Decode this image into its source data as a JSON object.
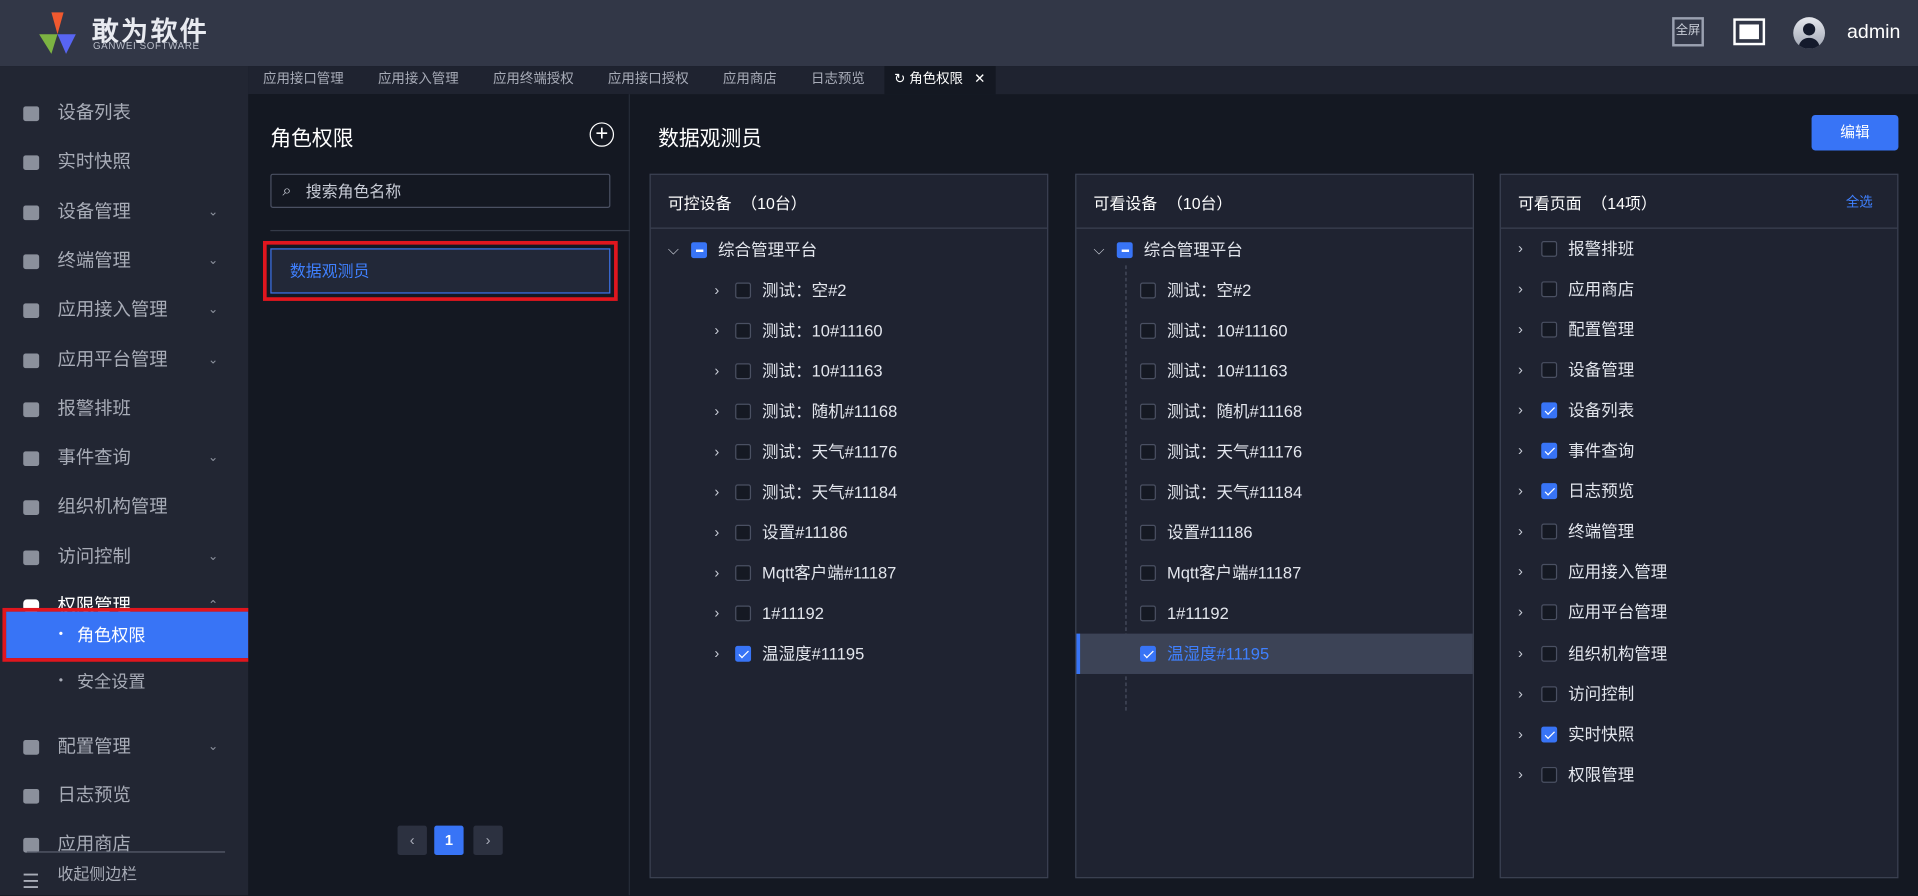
{
  "header": {
    "logo_text": "敢为软件",
    "logo_sub": "GANWEI SOFTWARE",
    "fullscreen_text_label": "全屏",
    "username": "admin"
  },
  "tabs": [
    "应用接口管理",
    "应用接入管理",
    "应用终端授权",
    "应用接口授权",
    "应用商店",
    "日志预览",
    "角色权限"
  ],
  "sidebar": {
    "items": [
      {
        "label": "设备列表",
        "icon": "monitor-icon",
        "chev": ""
      },
      {
        "label": "实时快照",
        "icon": "camera-icon",
        "chev": ""
      },
      {
        "label": "设备管理",
        "icon": "grid-icon",
        "chev": "⌄"
      },
      {
        "label": "终端管理",
        "icon": "grid-icon",
        "chev": "⌄"
      },
      {
        "label": "应用接入管理",
        "icon": "grid-icon",
        "chev": "⌄"
      },
      {
        "label": "应用平台管理",
        "icon": "grid-icon",
        "chev": "⌄"
      },
      {
        "label": "报警排班",
        "icon": "calendar-icon",
        "chev": ""
      },
      {
        "label": "事件查询",
        "icon": "search-doc-icon",
        "chev": "⌄"
      },
      {
        "label": "组织机构管理",
        "icon": "gear-icon",
        "chev": ""
      },
      {
        "label": "访问控制",
        "icon": "door-icon",
        "chev": "⌄"
      },
      {
        "label": "权限管理",
        "icon": "shield-icon",
        "chev": "⌃"
      }
    ],
    "sub_items": [
      {
        "label": "角色权限"
      },
      {
        "label": "安全设置"
      }
    ],
    "items_after": [
      {
        "label": "配置管理",
        "icon": "bookmark-icon",
        "chev": "⌄"
      },
      {
        "label": "日志预览",
        "icon": "receipt-icon",
        "chev": ""
      },
      {
        "label": "应用商店",
        "icon": "store-icon",
        "chev": ""
      }
    ],
    "collapse_label": "收起侧边栏"
  },
  "roles": {
    "title": "角色权限",
    "search_placeholder": "搜索角色名称",
    "items": [
      "数据观测员"
    ],
    "page": "1"
  },
  "main": {
    "title": "数据观测员",
    "edit_label": "编辑"
  },
  "panels": [
    {
      "title": "可控设备",
      "count": "（10台）",
      "root": "综合管理平台",
      "items": [
        {
          "label": "测试：空#2",
          "checked": false
        },
        {
          "label": "测试：10#11160",
          "checked": false
        },
        {
          "label": "测试：10#11163",
          "checked": false
        },
        {
          "label": "测试：随机#11168",
          "checked": false
        },
        {
          "label": "测试：天气#11176",
          "checked": false
        },
        {
          "label": "测试：天气#11184",
          "checked": false
        },
        {
          "label": "设置#11186",
          "checked": false
        },
        {
          "label": "Mqtt客户端#11187",
          "checked": false
        },
        {
          "label": "1#11192",
          "checked": false
        },
        {
          "label": "温湿度#11195",
          "checked": true
        }
      ]
    },
    {
      "title": "可看设备",
      "count": "（10台）",
      "root": "综合管理平台",
      "items": [
        {
          "label": "测试：空#2",
          "checked": false
        },
        {
          "label": "测试：10#11160",
          "checked": false
        },
        {
          "label": "测试：10#11163",
          "checked": false
        },
        {
          "label": "测试：随机#11168",
          "checked": false
        },
        {
          "label": "测试：天气#11176",
          "checked": false
        },
        {
          "label": "测试：天气#11184",
          "checked": false
        },
        {
          "label": "设置#11186",
          "checked": false
        },
        {
          "label": "Mqtt客户端#11187",
          "checked": false
        },
        {
          "label": "1#11192",
          "checked": false
        },
        {
          "label": "温湿度#11195",
          "checked": true
        }
      ]
    },
    {
      "title": "可看页面",
      "count": "（14项）",
      "select_all": "全选",
      "items": [
        {
          "label": "报警排班",
          "checked": false
        },
        {
          "label": "应用商店",
          "checked": false
        },
        {
          "label": "配置管理",
          "checked": false
        },
        {
          "label": "设备管理",
          "checked": false
        },
        {
          "label": "设备列表",
          "checked": true
        },
        {
          "label": "事件查询",
          "checked": true
        },
        {
          "label": "日志预览",
          "checked": true
        },
        {
          "label": "终端管理",
          "checked": false
        },
        {
          "label": "应用接入管理",
          "checked": false
        },
        {
          "label": "应用平台管理",
          "checked": false
        },
        {
          "label": "组织机构管理",
          "checked": false
        },
        {
          "label": "访问控制",
          "checked": false
        },
        {
          "label": "实时快照",
          "checked": true
        },
        {
          "label": "权限管理",
          "checked": false
        }
      ]
    }
  ],
  "colors": {
    "accent": "#3874f6",
    "highlight_outline": "#e0161e",
    "header_bg": "#323747",
    "sidebar_bg": "#222633"
  }
}
